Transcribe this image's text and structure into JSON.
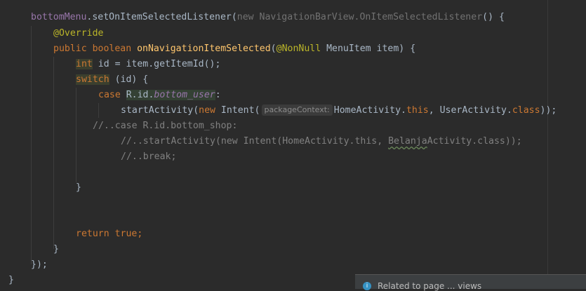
{
  "editor": {
    "lines": {
      "l1": {
        "receiver": "bottomMenu",
        "dot_method": ".setOnItemSelectedListener(",
        "new_kw": "new ",
        "listener_type": "NavigationBarView.OnItemSelectedListener",
        "end": "() {"
      },
      "l2": {
        "annotation": "@Override"
      },
      "l3": {
        "public_kw": "public ",
        "boolean_kw": "boolean ",
        "method_name": "onNavigationItemSelected",
        "open": "(",
        "nonnull": "@NonNull",
        "params": " MenuItem item) {"
      },
      "l4": {
        "int_kw": "int",
        "rest": " id = item.getItemId();"
      },
      "l5": {
        "switch_kw": "switch",
        "rest": " (id) {"
      },
      "l6": {
        "case_kw": "case ",
        "rid": "R.id.",
        "field": "bottom_user",
        "colon": ":"
      },
      "l7": {
        "call": "startActivity(",
        "new_kw": "new ",
        "intent": "Intent(",
        "hint": "packageContext:",
        "home": "HomeActivity.",
        "this_kw": "this",
        "comma": ", UserActivity.",
        "class_kw": "class",
        "close": "));"
      },
      "l8": {
        "comment": "//..case R.id.bottom_shop:"
      },
      "l9": {
        "comment_a": "//..startActivity(new Intent(HomeActivity.this, ",
        "comment_b": "Belanja",
        "comment_c": "Activity.class));"
      },
      "l10": {
        "comment": "//..break;"
      },
      "l11": {
        "text": "}"
      },
      "l12": {
        "return_kw": "return ",
        "true_kw": "true",
        "semi": ";"
      },
      "l13": {
        "text": "}"
      },
      "l14": {
        "text": "});"
      },
      "l15": {
        "text": "}"
      }
    }
  },
  "popup": {
    "icon": "info-icon",
    "text": "Related to page ... views"
  }
}
